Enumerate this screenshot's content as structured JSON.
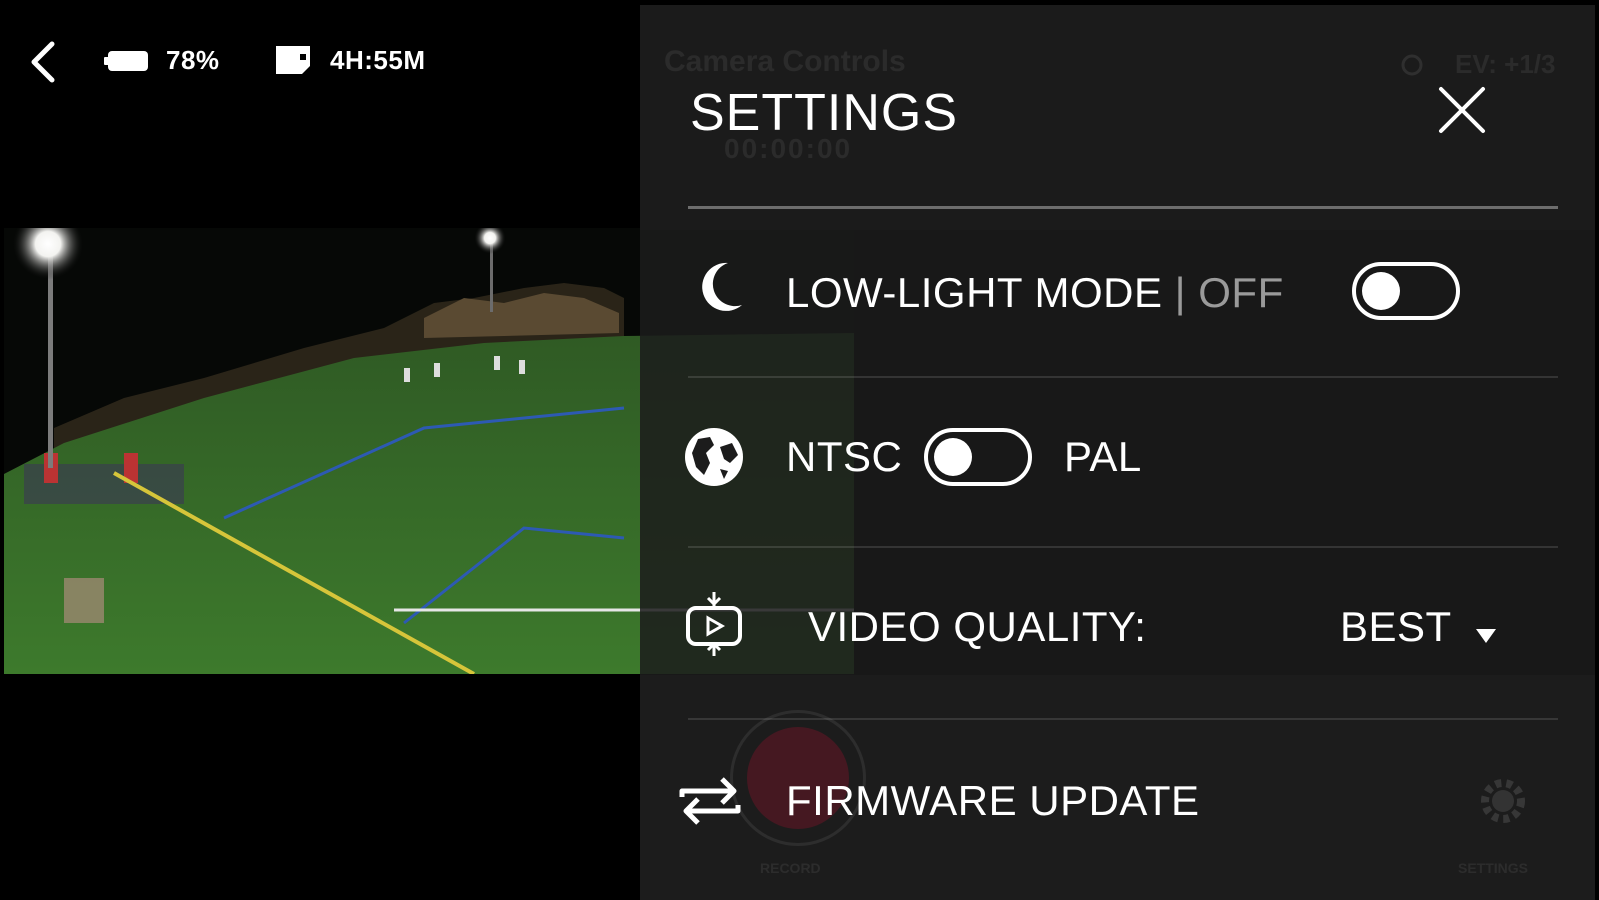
{
  "status": {
    "battery_text": "78%",
    "storage_text": "4H:55M"
  },
  "ghost": {
    "title": "Camera Controls",
    "timecode": "00:00:00",
    "ev": "EV: +1/3",
    "record_label": "RECORD",
    "settings_label": "SETTINGS"
  },
  "settings": {
    "title": "SETTINGS",
    "low_light": {
      "label": "LOW-LIGHT MODE",
      "separator": "|",
      "state": "OFF",
      "enabled": false
    },
    "video_standard": {
      "left_label": "NTSC",
      "right_label": "PAL",
      "selected": "NTSC"
    },
    "video_quality": {
      "label": "VIDEO QUALITY:",
      "value": "BEST"
    },
    "firmware": {
      "label": "FIRMWARE UPDATE"
    }
  },
  "icons": {
    "back": "chevron-left-icon",
    "battery": "battery-icon",
    "storage": "sd-card-icon",
    "close": "close-icon",
    "low_light": "moon-icon",
    "video_standard": "globe-icon",
    "video_quality": "video-quality-icon",
    "firmware": "update-arrows-icon"
  }
}
